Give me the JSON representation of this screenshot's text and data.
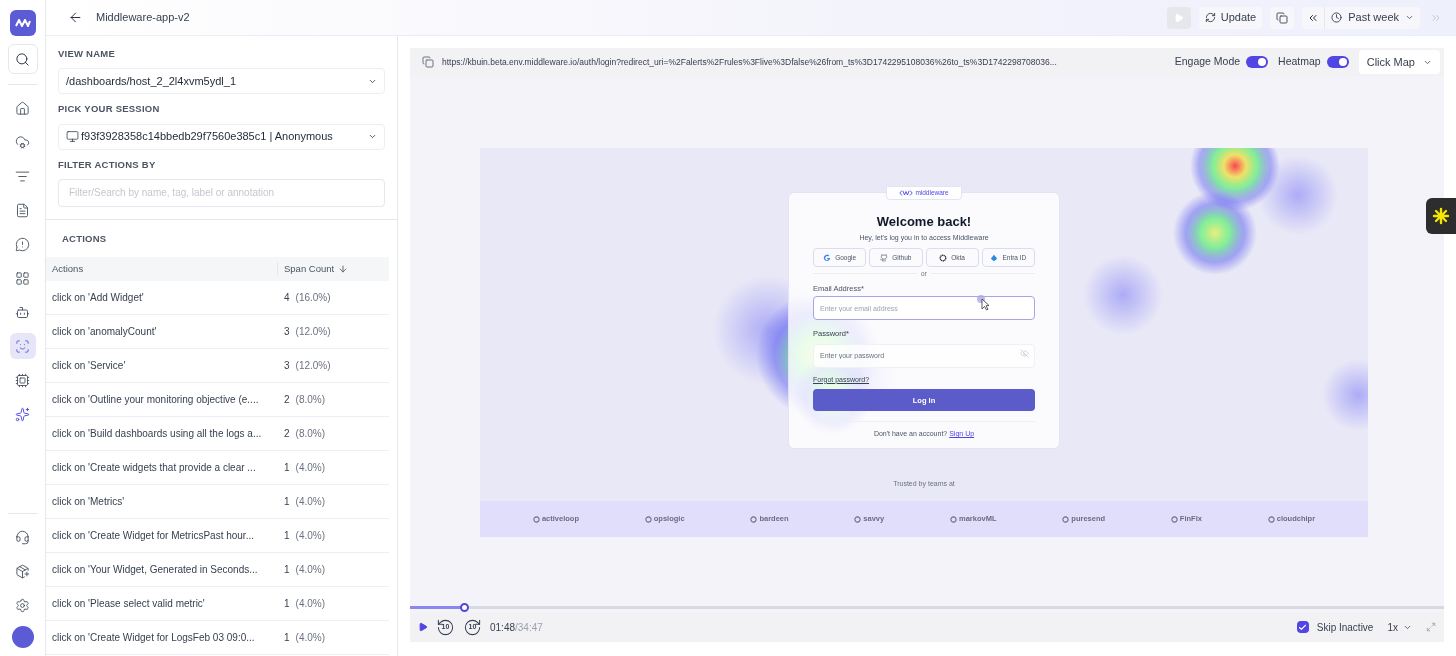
{
  "app_title": "Middleware-app-v2",
  "nav": [
    {
      "kind": "search",
      "selected": false
    },
    {
      "kind": "home",
      "selected": false
    },
    {
      "kind": "cloud",
      "selected": false
    },
    {
      "kind": "list",
      "selected": false
    },
    {
      "kind": "file",
      "selected": false
    },
    {
      "kind": "alert",
      "selected": false
    },
    {
      "kind": "widgets",
      "selected": false
    },
    {
      "kind": "bot",
      "selected": false
    },
    {
      "kind": "replay",
      "selected": true
    },
    {
      "kind": "chip",
      "selected": false
    },
    {
      "kind": "sparkle",
      "selected": false
    }
  ],
  "nav_bottom": [
    {
      "kind": "support",
      "selected": false
    },
    {
      "kind": "package",
      "selected": false
    },
    {
      "kind": "settings",
      "selected": false
    }
  ],
  "toolbar": {
    "play_disabled": true,
    "update": "Update",
    "range": "Past week",
    "next_disabled": true
  },
  "view_name": {
    "label": "VIEW NAME",
    "value": "/dashboards/host_2_2l4xvm5ydl_1"
  },
  "session": {
    "label": "PICK YOUR SESSION",
    "value": "f93f3928358c14bbedb29f7560e385c1 | Anonymous"
  },
  "filter": {
    "label": "FILTER ACTIONS BY",
    "placeholder": "Filter/Search by name, tag, label or annotation"
  },
  "actions": {
    "title": "ACTIONS",
    "columns": [
      "Actions",
      "Span Count"
    ],
    "rows": [
      {
        "action": "click on 'Add Widget'",
        "count": "4",
        "share": "(16.0%)"
      },
      {
        "action": "click on 'anomalyCount'",
        "count": "3",
        "share": "(12.0%)"
      },
      {
        "action": "click on 'Service'",
        "count": "3",
        "share": "(12.0%)"
      },
      {
        "action": "click on 'Outline your monitoring objective (e....",
        "count": "2",
        "share": "(8.0%)"
      },
      {
        "action": "click on 'Build dashboards using all the logs a...",
        "count": "2",
        "share": "(8.0%)"
      },
      {
        "action": "click on 'Create widgets that provide a clear ...",
        "count": "1",
        "share": "(4.0%)"
      },
      {
        "action": "click on 'Metrics'",
        "count": "1",
        "share": "(4.0%)"
      },
      {
        "action": "click on 'Create Widget for MetricsPast hour...",
        "count": "1",
        "share": "(4.0%)"
      },
      {
        "action": "click on 'Your Widget, Generated in Seconds...",
        "count": "1",
        "share": "(4.0%)"
      },
      {
        "action": "click on 'Please select valid metric'",
        "count": "1",
        "share": "(4.0%)"
      },
      {
        "action": "click on 'Create Widget for LogsFeb 03 09:0...",
        "count": "1",
        "share": "(4.0%)"
      }
    ]
  },
  "replay": {
    "url": "https://kbuin.beta.env.middleware.io/auth/login?redirect_uri=%2Falerts%2Frules%3Flive%3Dfalse%26from_ts%3D1742295108036%26to_ts%3D1742298708036...",
    "toggles": [
      {
        "label": "Engage Mode",
        "on": true
      },
      {
        "label": "Heatmap",
        "on": true
      }
    ],
    "mode": "Click Map"
  },
  "recorded_page": {
    "brand": "middleware",
    "title": "Welcome back!",
    "subtitle": "Hey, let's log you in to access Middleware",
    "sso": [
      {
        "kind": "google",
        "label": "Google"
      },
      {
        "kind": "github",
        "label": "Github"
      },
      {
        "kind": "okta",
        "label": "Okta"
      },
      {
        "kind": "entra",
        "label": "Entra ID"
      }
    ],
    "or": "or",
    "email_label": "Email Address*",
    "email_placeholder": "Enter your email address",
    "password_label": "Password*",
    "password_placeholder": "Enter your password",
    "forgot": "Forgot password?",
    "login": "Log In",
    "no_account": "Don't have an account?",
    "signup": "Sign Up",
    "trusted": "Trusted by teams at",
    "logos": [
      "activeloop",
      "opslogic",
      "bardeen",
      "savvy",
      "markovML",
      "puresend",
      "FinFlx",
      "cloudchipr"
    ]
  },
  "player": {
    "level": 0.052,
    "skip_back": "10",
    "skip_forward": "10",
    "time": "01:48",
    "duration": "/34:47",
    "skip_inactive": {
      "label": "Skip Inactive",
      "checked": true
    },
    "speed": "1x"
  }
}
